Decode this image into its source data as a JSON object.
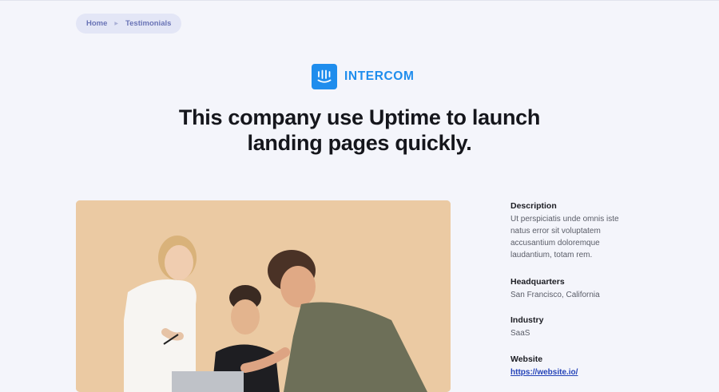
{
  "breadcrumb": {
    "items": [
      "Home",
      "Testimonials"
    ]
  },
  "brand": {
    "logo_icon": "intercom-logo-icon",
    "name": "INTERCOM",
    "color": "#1f8ded"
  },
  "headline": {
    "line1": "This company use Uptime to launch",
    "line2": "landing pages quickly."
  },
  "photo": {
    "alt": "team-photo",
    "background": "#ebcaa3"
  },
  "details": {
    "description": {
      "label": "Description",
      "value": "Ut perspiciatis unde omnis iste natus error sit voluptatem accusantium doloremque laudantium, totam rem."
    },
    "headquarters": {
      "label": "Headquarters",
      "value": "San Francisco, California"
    },
    "industry": {
      "label": "Industry",
      "value": "SaaS"
    },
    "website": {
      "label": "Website",
      "value": "https://website.io/"
    }
  },
  "colors": {
    "page_bg": "#f4f5fb",
    "breadcrumb_bg": "#e3e6f6",
    "link": "#2443b8"
  }
}
